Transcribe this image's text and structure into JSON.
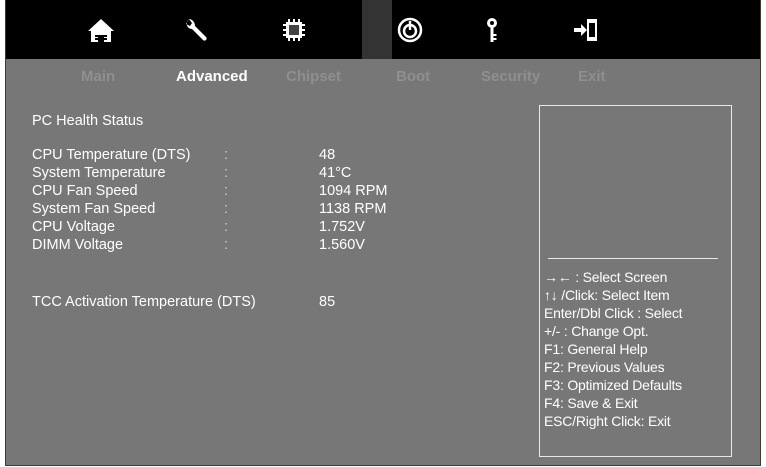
{
  "icons": [
    {
      "name": "home-icon",
      "active": false
    },
    {
      "name": "wrench-icon",
      "active": false
    },
    {
      "name": "chip-icon",
      "active": false
    },
    {
      "name": "power-icon",
      "active": true
    },
    {
      "name": "key-icon",
      "active": false
    },
    {
      "name": "exit-door-icon",
      "active": false
    }
  ],
  "menu": {
    "main": "Main",
    "advanced": "Advanced",
    "chipset": "Chipset",
    "boot": "Boot",
    "security": "Security",
    "exit": "Exit",
    "active": "Advanced"
  },
  "section_title": "PC Health Status",
  "readings": [
    {
      "label": "CPU Temperature (DTS)",
      "sep": ":",
      "value": "48"
    },
    {
      "label": "System Temperature",
      "sep": ":",
      "value": "41°C"
    },
    {
      "label": "CPU Fan Speed",
      "sep": ":",
      "value": "1094 RPM"
    },
    {
      "label": "System Fan Speed",
      "sep": ":",
      "value": "1138 RPM"
    },
    {
      "label": "CPU Voltage",
      "sep": ":",
      "value": "1.752V"
    },
    {
      "label": "DIMM Voltage",
      "sep": ":",
      "value": "1.560V"
    }
  ],
  "tcc": {
    "label": "TCC Activation Temperature (DTS)",
    "value": "85"
  },
  "help": [
    "→← : Select Screen",
    "↑↓ /Click: Select Item",
    "Enter/Dbl Click : Select",
    "+/- : Change Opt.",
    "F1: General Help",
    "F2: Previous Values",
    "F3: Optimized Defaults",
    "F4: Save & Exit",
    "ESC/Right Click: Exit"
  ],
  "colors": {
    "background": "#777777",
    "icon_bar": "#000000",
    "active_tab": "#ffffff",
    "inactive_tab": "#8f8f8f"
  }
}
